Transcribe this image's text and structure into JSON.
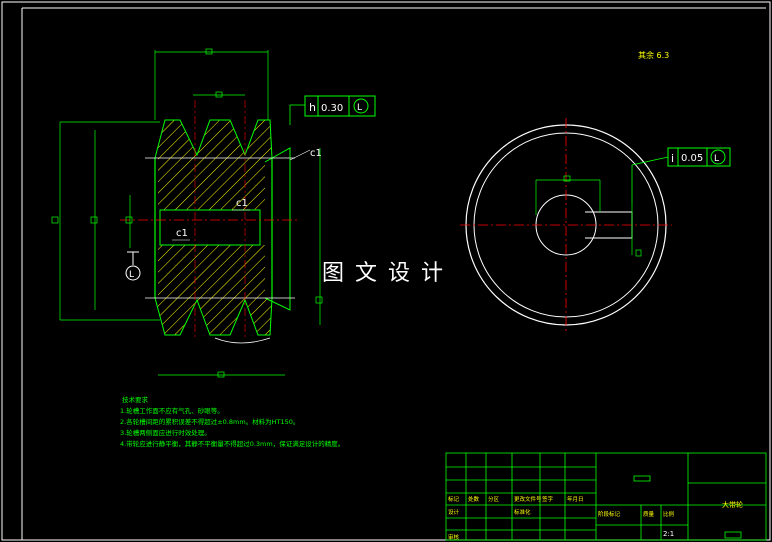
{
  "watermark": "图 文 设 计",
  "roughness_note": "其余 6.3",
  "tol_frame_side": {
    "symbol": "h",
    "value": "0.30",
    "datum": "L"
  },
  "tol_frame_right": {
    "symbol": "i",
    "value": "0.05",
    "datum": "L"
  },
  "datum_label": "L",
  "chamfer_labels": [
    "c1",
    "c1",
    "c1"
  ],
  "tech_requirements": {
    "title": "技术要求",
    "items": [
      "1.轮槽工作面不应有气孔、砂眼等。",
      "2.各轮槽间距的累积误差不得超过±0.8mm。材料为HT150。",
      "3.轮槽两侧面应进行时效处理。",
      "4.带轮应进行静平衡，其静不平衡量不得超过0.3mm，保证满足设计的精度。"
    ]
  },
  "title_block": {
    "part_name": "大带轮",
    "row1": [
      "标记",
      "处数",
      "分区",
      "更改文件号",
      "签字",
      "年月日"
    ],
    "row2": [
      "设计",
      "",
      "",
      "标准化",
      "",
      ""
    ],
    "stage_labels": [
      "阶段标记",
      "质量",
      "比例"
    ],
    "scale": "2:1",
    "review": "审核"
  },
  "colors": {
    "outline": "#ffffff",
    "part": "#00ff00",
    "hatch": "#ffff00",
    "center": "#ff0000",
    "text": "#ffffff"
  }
}
